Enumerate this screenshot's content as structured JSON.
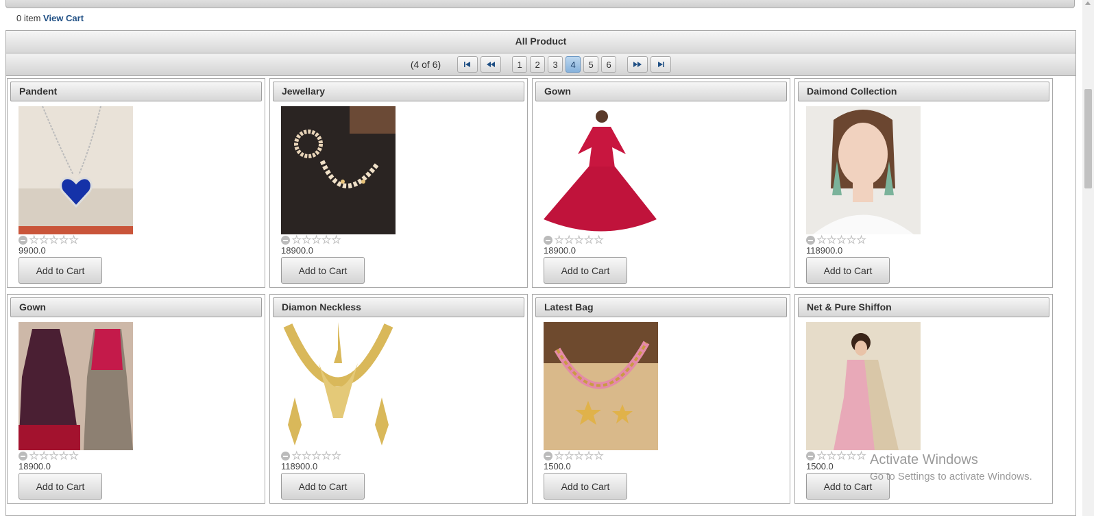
{
  "cart": {
    "count_text": "0 item",
    "link": "View Cart"
  },
  "section_title": "All Product",
  "pager": {
    "info": "(4 of 6)",
    "first": "⏮",
    "prev": "◀◀",
    "pages": [
      "1",
      "2",
      "3",
      "4",
      "5",
      "6"
    ],
    "active_page": "4",
    "next": "▶▶",
    "last": "⏭"
  },
  "products": [
    {
      "name": "Pandent",
      "price": "9900.0",
      "button": "Add to Cart",
      "image": "pendant-image"
    },
    {
      "name": "Jewellary",
      "price": "18900.0",
      "button": "Add to Cart",
      "image": "pearl-set-image"
    },
    {
      "name": "Gown",
      "price": "18900.0",
      "button": "Add to Cart",
      "image": "red-gown-image"
    },
    {
      "name": "Daimond Collection",
      "price": "118900.0",
      "button": "Add to Cart",
      "image": "earrings-model-image"
    },
    {
      "name": "Gown",
      "price": "18900.0",
      "button": "Add to Cart",
      "image": "gowns-image"
    },
    {
      "name": "Diamon Neckless",
      "price": "118900.0",
      "button": "Add to Cart",
      "image": "gold-necklace-image"
    },
    {
      "name": "Latest Bag",
      "price": "1500.0",
      "button": "Add to Cart",
      "image": "bag-chain-image"
    },
    {
      "name": "Net & Pure Shiffon",
      "price": "1500.0",
      "button": "Add to Cart",
      "image": "saree-image"
    }
  ],
  "rating": {
    "stars": 5,
    "value": 0
  },
  "watermark": {
    "line1": "Activate Windows",
    "line2": "Go to Settings to activate Windows."
  }
}
